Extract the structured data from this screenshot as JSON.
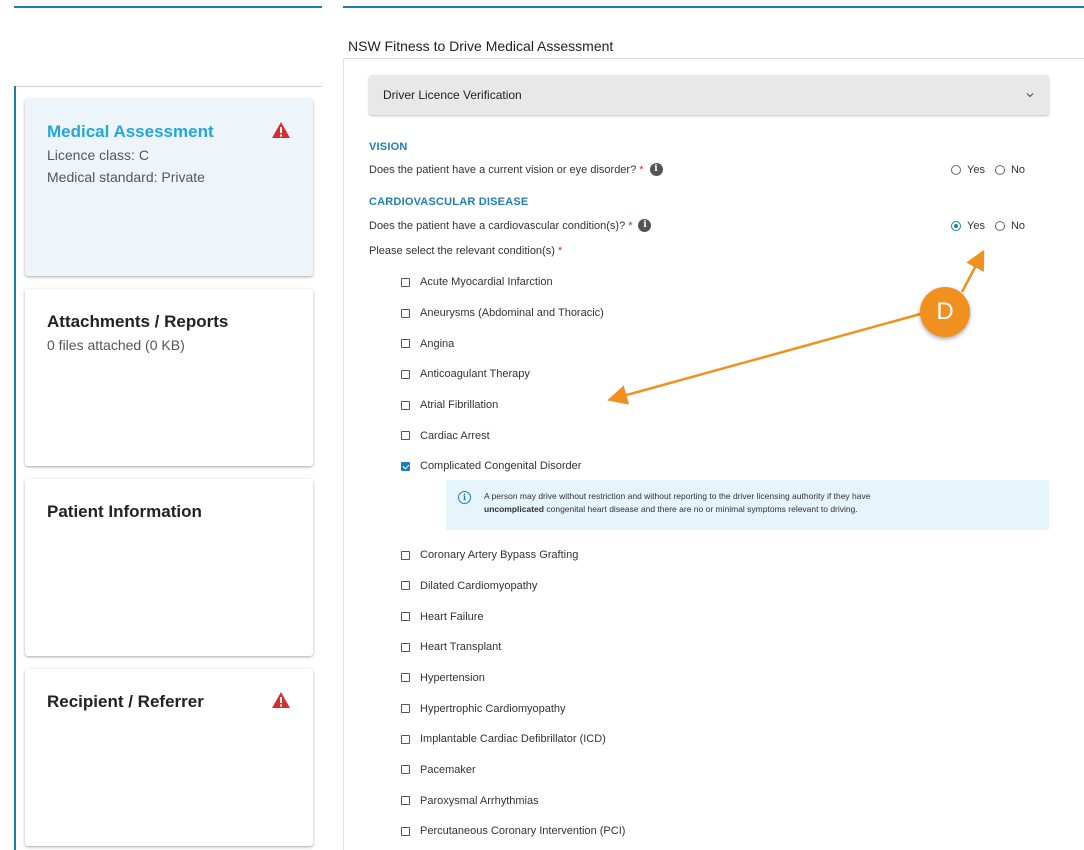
{
  "sidebar": {
    "cards": [
      {
        "title": "Medical Assessment",
        "lines": [
          "Licence class: C",
          "Medical standard: Private"
        ],
        "warning": true,
        "active": true
      },
      {
        "title": "Attachments / Reports",
        "lines": [
          "0 files attached (0 KB)"
        ],
        "warning": false,
        "active": false
      },
      {
        "title": "Patient Information",
        "lines": [],
        "warning": false,
        "active": false
      },
      {
        "title": "Recipient / Referrer",
        "lines": [],
        "warning": true,
        "active": false
      }
    ]
  },
  "form": {
    "title": "NSW Fitness to Drive Medical Assessment",
    "accordion_label": "Driver Licence Verification",
    "vision": {
      "heading": "VISION",
      "question": "Does the patient have a current vision or eye disorder?",
      "required": "*",
      "yes_label": "Yes",
      "no_label": "No",
      "selected": "none"
    },
    "cardio": {
      "heading": "CARDIOVASCULAR DISEASE",
      "question": "Does the patient have a cardiovascular condition(s)?",
      "required": "*",
      "yes_label": "Yes",
      "no_label": "No",
      "selected": "yes",
      "select_prompt": "Please select the relevant condition(s)",
      "conditions_before": [
        {
          "label": "Acute Myocardial Infarction",
          "checked": false
        },
        {
          "label": "Aneurysms (Abdominal and Thoracic)",
          "checked": false
        },
        {
          "label": "Angina",
          "checked": false
        },
        {
          "label": "Anticoagulant Therapy",
          "checked": false
        },
        {
          "label": "Atrial Fibrillation",
          "checked": false
        },
        {
          "label": "Cardiac Arrest",
          "checked": false
        },
        {
          "label": "Complicated Congenital Disorder",
          "checked": true
        }
      ],
      "info_text_1": "A person may drive without restriction and without reporting to the driver licensing authority if they have",
      "info_bold": "uncomplicated",
      "info_text_2": "congenital heart disease and there are no or minimal symptoms relevant to driving.",
      "conditions_after": [
        {
          "label": "Coronary Artery Bypass Grafting",
          "checked": false
        },
        {
          "label": "Dilated Cardiomyopathy",
          "checked": false
        },
        {
          "label": "Heart Failure",
          "checked": false
        },
        {
          "label": "Heart Transplant",
          "checked": false
        },
        {
          "label": "Hypertension",
          "checked": false
        },
        {
          "label": "Hypertrophic Cardiomyopathy",
          "checked": false
        },
        {
          "label": "Implantable Cardiac Defibrillator (ICD)",
          "checked": false
        },
        {
          "label": "Pacemaker",
          "checked": false
        },
        {
          "label": "Paroxysmal Arrhythmias",
          "checked": false
        },
        {
          "label": "Percutaneous Coronary Intervention (PCI)",
          "checked": false
        }
      ]
    }
  },
  "annotation": {
    "badge_label": "D",
    "color": "#f0901e"
  },
  "colors": {
    "accent": "#1e7fb0",
    "active_title": "#22a7d8",
    "warning": "#d32f2f"
  },
  "icons": {
    "warning": "warning-triangle-icon",
    "info": "info-icon",
    "chevron": "chevron-down-icon"
  }
}
